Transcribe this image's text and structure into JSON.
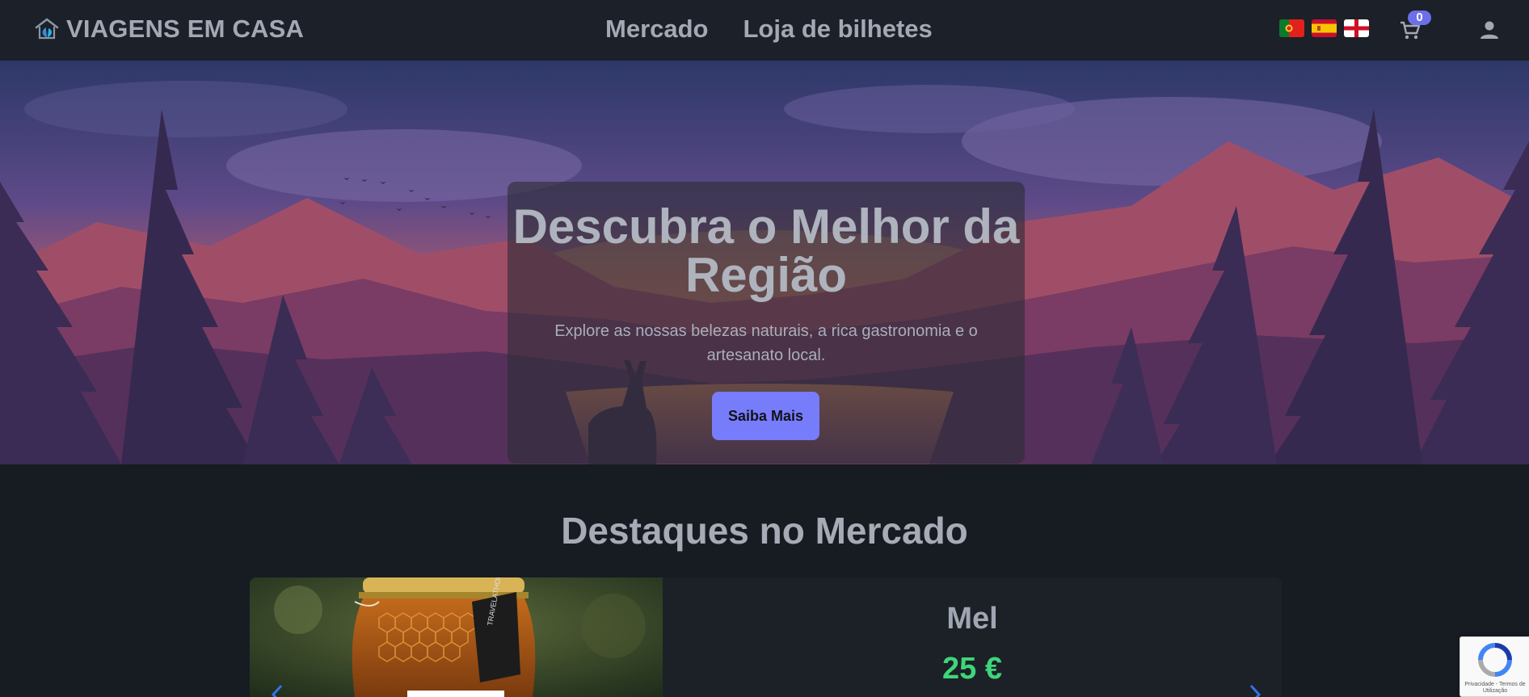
{
  "navbar": {
    "brand": "VIAGENS EM CASA",
    "links": [
      "Mercado",
      "Loja de bilhetes"
    ],
    "languages": [
      "pt",
      "es",
      "en"
    ],
    "cart_count": "0",
    "icons": [
      "house-leaf-icon",
      "cart-icon",
      "user-icon"
    ]
  },
  "hero": {
    "title": "Descubra o Melhor da Região",
    "subtitle": "Explore as nossas belezas naturais, a rica gastronomia e o artesanato local.",
    "button": "Saiba Mais"
  },
  "featured": {
    "title": "Destaques no Mercado",
    "product": {
      "name": "Mel",
      "price": "25 €",
      "label_text": "TRAVELATHOME"
    }
  },
  "recaptcha": {
    "text": "Privacidade - Termos de Utilização"
  },
  "colors": {
    "accent": "#777cfb",
    "price": "#3fd57a",
    "background": "#171b22",
    "navbar": "#1c2028"
  }
}
